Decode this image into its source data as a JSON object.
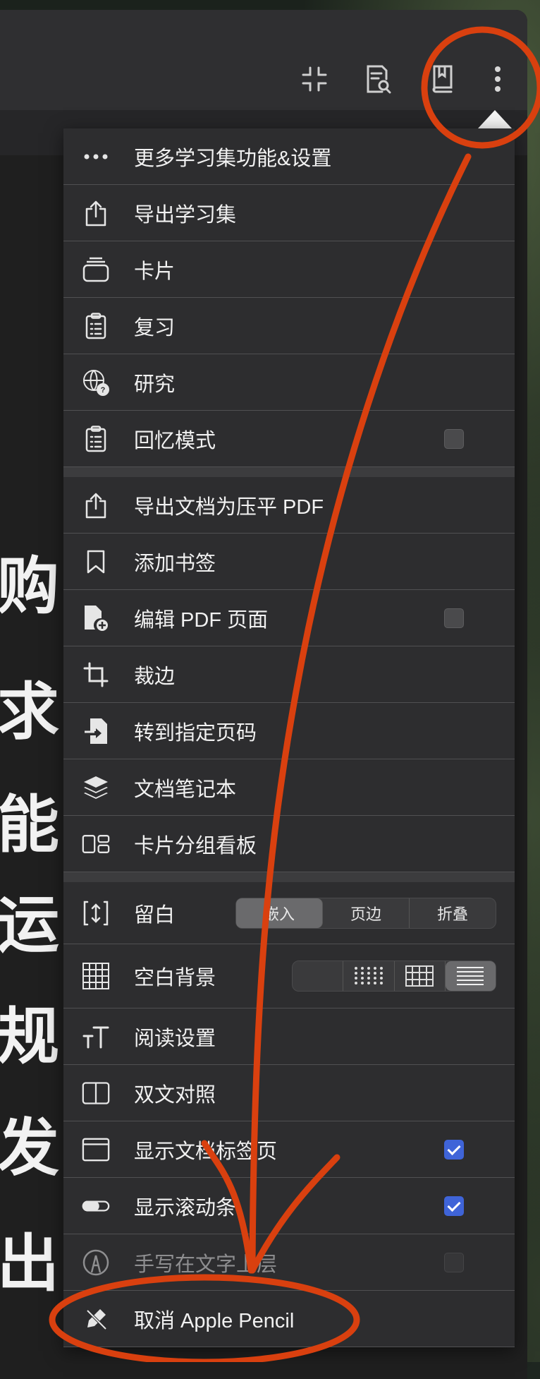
{
  "toolbar": {
    "icons": [
      "collapse-icon",
      "document-search-icon",
      "book-icon",
      "more-vertical-icon"
    ]
  },
  "document": {
    "glyphs": [
      "购",
      "求",
      "能",
      "运",
      "规",
      "发",
      "出"
    ]
  },
  "menu": {
    "section1": [
      {
        "label": "更多学习集功能&设置",
        "icon": "ellipsis-icon"
      },
      {
        "label": "导出学习集",
        "icon": "share-icon"
      },
      {
        "label": "卡片",
        "icon": "cards-icon"
      },
      {
        "label": "复习",
        "icon": "clipboard-icon"
      },
      {
        "label": "研究",
        "icon": "web-help-icon"
      },
      {
        "label": "回忆模式",
        "icon": "clipboard-icon",
        "checkbox": false
      }
    ],
    "section2": [
      {
        "label": "导出文档为压平 PDF",
        "icon": "share-icon"
      },
      {
        "label": "添加书签",
        "icon": "bookmark-icon"
      },
      {
        "label": "编辑 PDF 页面",
        "icon": "doc-add-icon",
        "checkbox": false
      },
      {
        "label": "裁边",
        "icon": "crop-icon"
      },
      {
        "label": "转到指定页码",
        "icon": "goto-page-icon"
      },
      {
        "label": "文档笔记本",
        "icon": "layers-icon"
      },
      {
        "label": "卡片分组看板",
        "icon": "board-icon"
      }
    ],
    "section3": {
      "margin": {
        "label": "留白",
        "icon": "margin-icon",
        "options": [
          "嵌入",
          "页边",
          "折叠"
        ],
        "selected": "嵌入"
      },
      "background": {
        "label": "空白背景",
        "icon": "grid-icon",
        "options": [
          "blank",
          "dots",
          "grid",
          "lines"
        ],
        "selected": "lines"
      },
      "items": [
        {
          "label": "阅读设置",
          "icon": "text-size-icon"
        },
        {
          "label": "双文对照",
          "icon": "split-view-icon"
        },
        {
          "label": "显示文档标签页",
          "icon": "window-icon",
          "checkbox": true
        },
        {
          "label": "显示滚动条",
          "icon": "scrollbar-icon",
          "checkbox": true
        },
        {
          "label": "手写在文字上层",
          "icon": "pencil-circle-icon",
          "checkbox": false,
          "disabled": true
        },
        {
          "label": "取消 Apple Pencil",
          "icon": "pencil-slash-icon"
        }
      ]
    }
  },
  "colors": {
    "annotation": "#d9400f",
    "checkbox_on": "#3f64d8",
    "menu_bg": "#2d2d2f"
  }
}
